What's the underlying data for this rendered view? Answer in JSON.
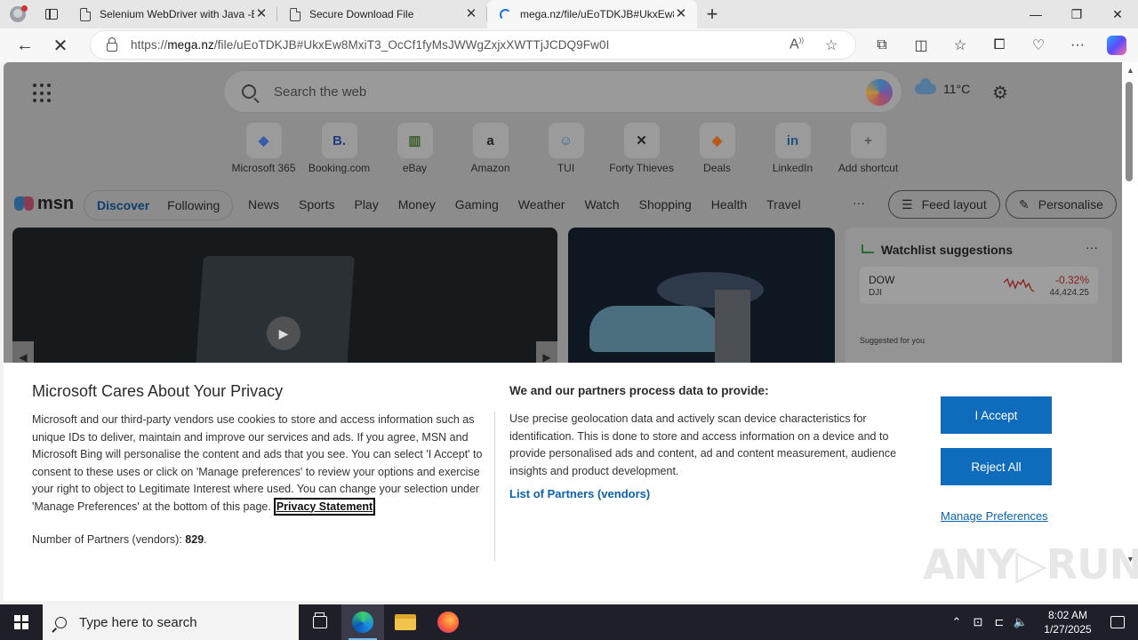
{
  "browser": {
    "tabs": [
      {
        "title": "Selenium WebDriver with Java -B",
        "state": "inactive",
        "icon": "document-icon"
      },
      {
        "title": "Secure Download File",
        "state": "inactive",
        "icon": "document-icon"
      },
      {
        "title": "mega.nz/file/uEoTDKJB#UkxEw8",
        "state": "active-loading",
        "icon": "loading-spinner-icon"
      }
    ],
    "close_glyph": "✕",
    "new_tab_glyph": "+",
    "window_controls": {
      "minimize": "—",
      "maximize": "❐",
      "close": "✕"
    },
    "url_host_prefix": "https://",
    "url_host": "mega.nz",
    "url_path": "/file/uEoTDKJB#UkxEw8MxiT3_OcCf1fyMsJWWgZxjxXWTTjJCDQ9Fw0I",
    "nav": {
      "back": "←",
      "stop": "✕"
    }
  },
  "newtab": {
    "search_placeholder": "Search the web",
    "weather_temp": "11°C",
    "shortcuts": [
      {
        "label": "Microsoft 365",
        "glyph": "◆",
        "color": "#3b5aa8"
      },
      {
        "label": "Booking.com",
        "glyph": "B.",
        "color": "#1f3f7a"
      },
      {
        "label": "eBay",
        "glyph": "▥",
        "color": "#3a5d2a"
      },
      {
        "label": "Amazon",
        "glyph": "a",
        "color": "#222222"
      },
      {
        "label": "TUI",
        "glyph": "☺",
        "color": "#2e6fa8"
      },
      {
        "label": "Forty Thieves",
        "glyph": "✕",
        "color": "#222222"
      },
      {
        "label": "Deals",
        "glyph": "◆",
        "color": "#b85a1e"
      },
      {
        "label": "LinkedIn",
        "glyph": "in",
        "color": "#1f4f7d"
      },
      {
        "label": "Add shortcut",
        "glyph": "+",
        "color": "#555555"
      }
    ]
  },
  "msn": {
    "logo": "msn",
    "feed_tabs": [
      "Discover",
      "Following"
    ],
    "nav": [
      "News",
      "Sports",
      "Play",
      "Money",
      "Gaming",
      "Weather",
      "Watch",
      "Shopping",
      "Health",
      "Travel"
    ],
    "more": "···",
    "feed_layout": "Feed layout",
    "personalise": "Personalise",
    "watchlist": {
      "title": "Watchlist suggestions",
      "more": "···",
      "stock": {
        "symbol": "DOW",
        "index": "DJI",
        "change": "-0.32%",
        "value": "44,424.25"
      },
      "suggested_label": "Suggested for you"
    }
  },
  "privacy": {
    "title": "Microsoft Cares About Your Privacy",
    "body": "Microsoft and our third-party vendors use cookies to store and access information such as unique IDs to deliver, maintain and improve our services and ads. If you agree, MSN and Microsoft Bing will personalise the content and ads that you see. You can select 'I Accept' to consent to these uses or click on 'Manage preferences' to review your options and exercise your right to object to Legitimate Interest where used.  You can change your selection under 'Manage Preferences' at the bottom of this page.",
    "privacy_link": "Privacy Statement",
    "partners_label": "Number of Partners (vendors):",
    "partners_count": "829",
    "partners_suffix": ".",
    "process_heading": "We and our partners process data to provide:",
    "process_body": "Use precise geolocation data and actively scan device characteristics for identification. This is done to store and access information on a device and to provide personalised ads and content, ad and content measurement, audience insights and product development.",
    "vendors_link": "List of Partners (vendors)",
    "accept": "I Accept",
    "reject": "Reject All",
    "manage": "Manage Preferences"
  },
  "watermark": "ANY▷RUN",
  "taskbar": {
    "search_placeholder": "Type here to search",
    "time": "8:02 AM",
    "date": "1/27/2025"
  }
}
